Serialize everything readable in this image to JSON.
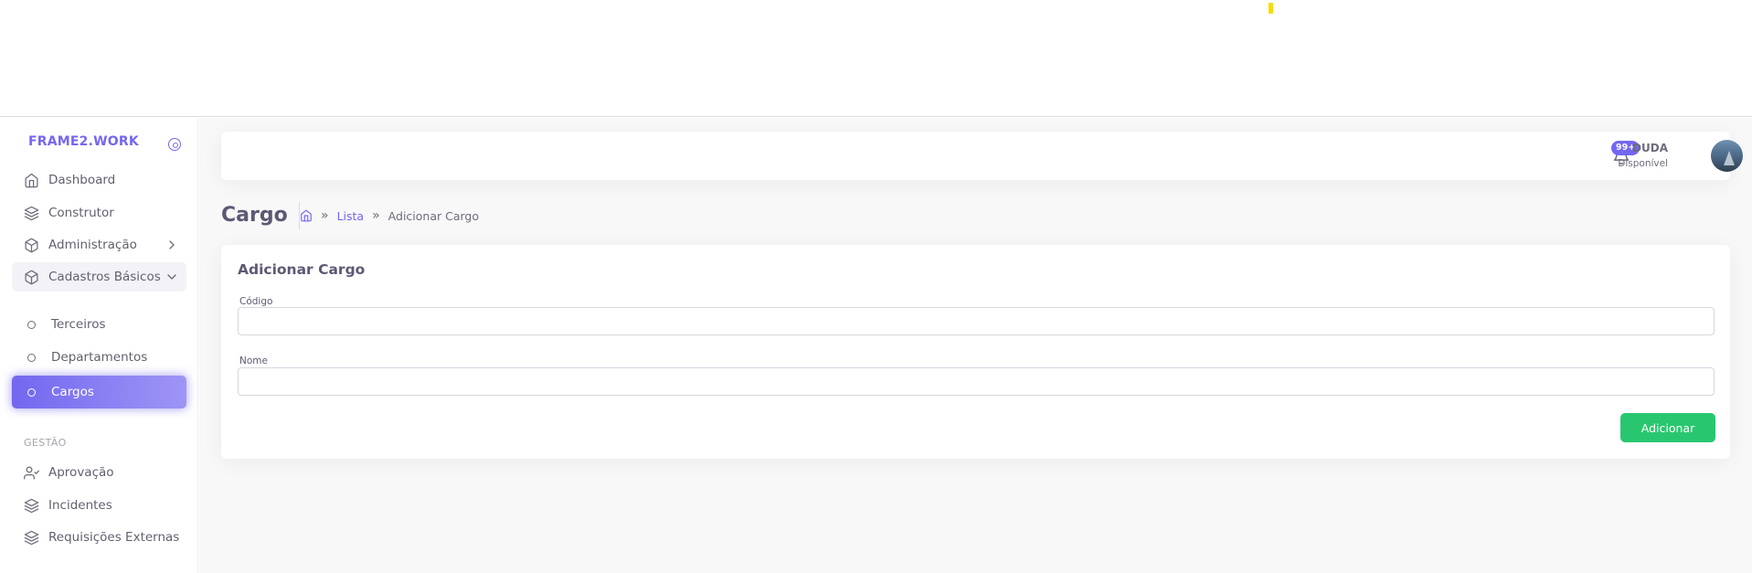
{
  "app": {
    "brand": "FRAME2.WORK"
  },
  "sidebar": {
    "items": [
      {
        "label": "Dashboard",
        "icon": "home-icon"
      },
      {
        "label": "Construtor",
        "icon": "layers-icon"
      },
      {
        "label": "Administração",
        "icon": "package-icon"
      },
      {
        "label": "Cadastros Básicos",
        "icon": "package-icon"
      }
    ],
    "sub_items": [
      {
        "label": "Terceiros"
      },
      {
        "label": "Departamentos"
      },
      {
        "label": "Cargos",
        "active": true
      }
    ],
    "section_label": "GESTÃO",
    "gestao_items": [
      {
        "label": "Aprovação",
        "icon": "user-check-icon"
      },
      {
        "label": "Incidentes",
        "icon": "layers-icon"
      },
      {
        "label": "Requisições Externas",
        "icon": "layers-icon"
      }
    ]
  },
  "navbar": {
    "notifications_badge": "99+",
    "user_name": "DUDA",
    "user_status": "Disponível"
  },
  "header": {
    "title": "Cargo",
    "breadcrumb": {
      "link": "Lista",
      "current": "Adicionar Cargo"
    }
  },
  "form": {
    "title": "Adicionar Cargo",
    "fields": [
      {
        "label": "Código",
        "value": "",
        "placeholder": ""
      },
      {
        "label": "Nome",
        "value": "",
        "placeholder": ""
      }
    ],
    "submit_label": "Adicionar"
  },
  "colors": {
    "accent": "#7367f0",
    "success": "#28c76f",
    "marker": "#f7dc00"
  }
}
